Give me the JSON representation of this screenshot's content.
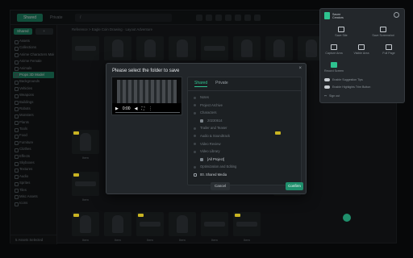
{
  "app": {
    "tabs": [
      "Shared",
      "Private"
    ],
    "address": "/",
    "new_label": "+",
    "crumbs": "Reference > Eagle Coin Drawing · Layout Adventure"
  },
  "sidebar": {
    "items": [
      "Assets",
      "Collections",
      "Anime Characters Male",
      "Anime Female",
      "Animals",
      "Props 3D Model",
      "Backgrounds",
      "Vehicles",
      "Weapons",
      "Buildings",
      "Robots",
      "Monsters",
      "Plants",
      "Tools",
      "Food",
      "Furniture",
      "Clothes",
      "Effects",
      "Skyboxes",
      "Textures",
      "Audio",
      "Sprites",
      "Tiles",
      "Misc Assets",
      "Icons"
    ],
    "selected_index": 5,
    "footer": "5 Assets Selected"
  },
  "grid": {
    "labels": [
      "Item",
      "Item",
      "Item",
      "Item",
      "Item",
      "Item",
      "Item",
      "Item"
    ]
  },
  "dialog": {
    "title": "Please select the folder to save",
    "close_glyph": "×",
    "player": {
      "time": "0:00"
    },
    "tabs": [
      "Shared",
      "Private"
    ],
    "active_tab": "Shared",
    "tree": [
      {
        "label": "Notes",
        "kind": "dot"
      },
      {
        "label": "Project Archive",
        "kind": "dot"
      },
      {
        "label": "Characters",
        "kind": "dot"
      },
      {
        "label": "20230614",
        "kind": "sub"
      },
      {
        "label": "Trailer and Teaser",
        "kind": "dot"
      },
      {
        "label": "Audio & Soundtrack",
        "kind": "dot"
      },
      {
        "label": "Video Review",
        "kind": "dot"
      },
      {
        "label": "Video Library",
        "kind": "dot"
      },
      {
        "label": "[All Project]",
        "kind": "sub",
        "bright": true
      },
      {
        "label": "Optimization and Editing",
        "kind": "dot"
      },
      {
        "label": "00. Shared Media",
        "kind": "ring",
        "bright": true
      }
    ],
    "cancel_label": "Cancel",
    "confirm_label": "Confirm"
  },
  "extension": {
    "brand": "Savee Creators",
    "items": [
      {
        "label": "Save Site",
        "icon": "bookmark-icon"
      },
      {
        "label": "Save Screenshot",
        "icon": "screenshot-icon"
      },
      {
        "label": "Capture Area",
        "icon": "crop-icon"
      },
      {
        "label": "Visible Area",
        "icon": "eye-icon"
      },
      {
        "label": "Full Page",
        "icon": "page-icon"
      },
      {
        "label": "Record Screen",
        "icon": "video-icon",
        "active": true
      }
    ],
    "toggles": [
      "Enable Suggestion Tips",
      "Enable Highlights Trim Button"
    ],
    "signout": "Sign out"
  },
  "colors": {
    "accent": "#1f8f6c",
    "tag": "#c9b422"
  }
}
